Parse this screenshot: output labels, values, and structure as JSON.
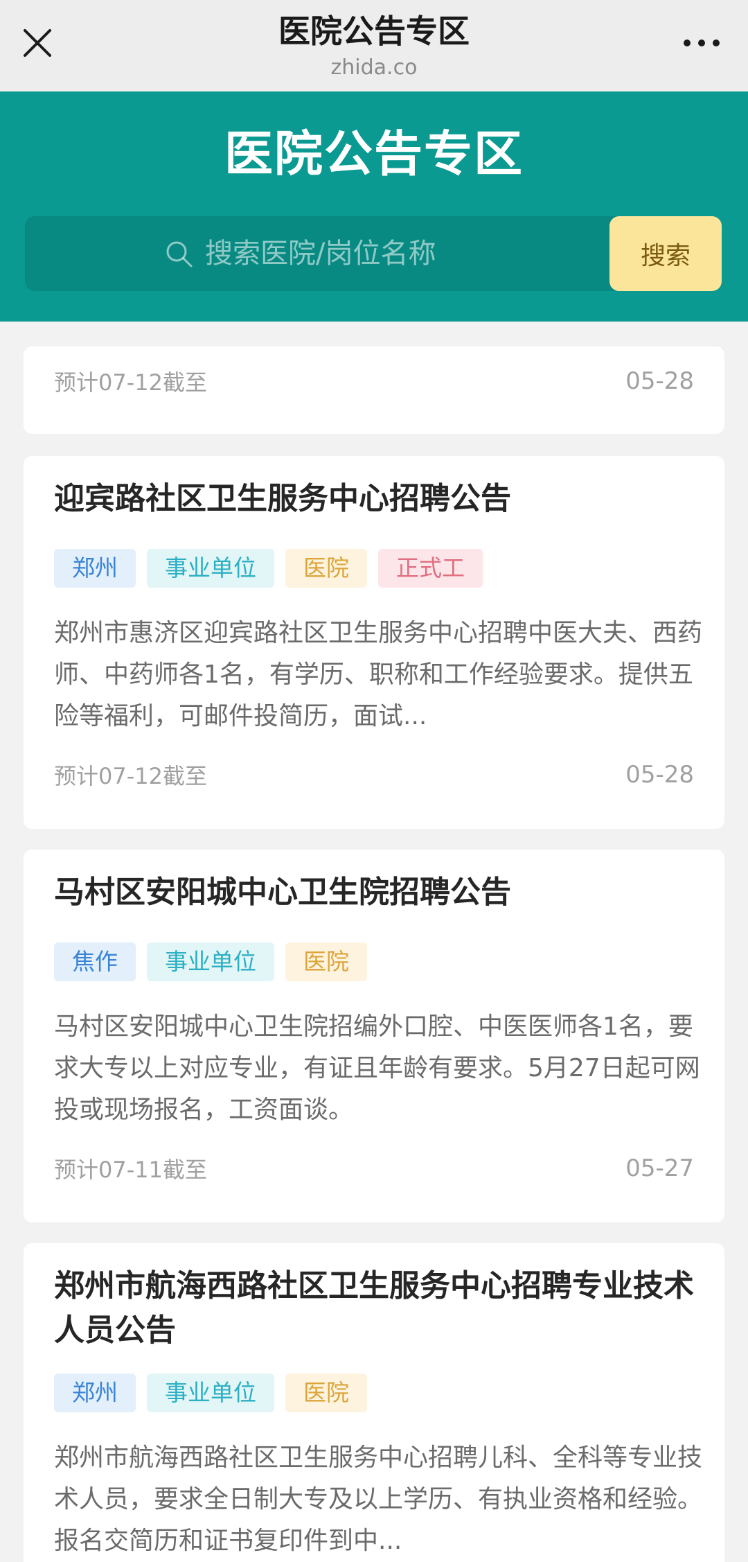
{
  "topbar": {
    "title": "医院公告专区",
    "domain": "zhida.co",
    "close_icon": "close-icon",
    "more_icon": "more-icon"
  },
  "hero": {
    "title": "医院公告专区",
    "search": {
      "placeholder": "搜索医院/岗位名称",
      "button_label": "搜索"
    }
  },
  "list": {
    "partial_card": {
      "deadline": "预计07-12截至",
      "date": "05-28"
    },
    "cards": [
      {
        "title": "迎宾路社区卫生服务中心招聘公告",
        "tags": [
          "郑州",
          "事业单位",
          "医院",
          "正式工"
        ],
        "desc": "郑州市惠济区迎宾路社区卫生服务中心招聘中医大夫、西药师、中药师各1名，有学历、职称和工作经验要求。提供五险等福利，可邮件投简历，面试...",
        "deadline": "预计07-12截至",
        "date": "05-28"
      },
      {
        "title": "马村区安阳城中心卫生院招聘公告",
        "tags": [
          "焦作",
          "事业单位",
          "医院"
        ],
        "desc": "马村区安阳城中心卫生院招编外口腔、中医医师各1名，要求大专以上对应专业，有证且年龄有要求。5月27日起可网投或现场报名，工资面谈。",
        "deadline": "预计07-11截至",
        "date": "05-27"
      },
      {
        "title": "郑州市航海西路社区卫生服务中心招聘专业技术人员公告",
        "tags": [
          "郑州",
          "事业单位",
          "医院"
        ],
        "desc": "郑州市航海西路社区卫生服务中心招聘儿科、全科等专业技术人员，要求全日制大专及以上学历、有执业资格和经验。报名交简历和证书复印件到中..."
      }
    ]
  }
}
